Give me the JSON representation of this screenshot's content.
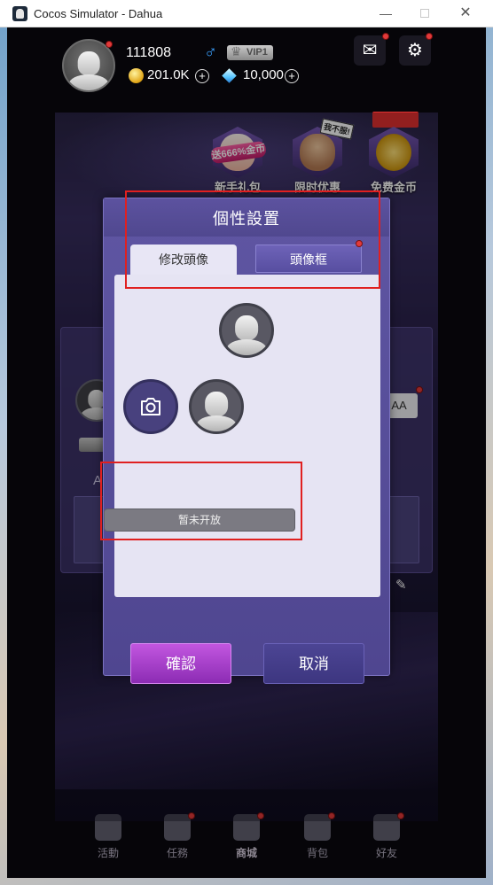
{
  "window": {
    "title": "Cocos Simulator - Dahua"
  },
  "header": {
    "user_id": "111808",
    "gender_symbol": "♂",
    "vip": "VIP1",
    "coins": "201.0K",
    "diamonds": "10,000",
    "plus_symbol": "+"
  },
  "promos": [
    {
      "label": "新手礼包",
      "tag": "送666%金币"
    },
    {
      "label": "限时优惠",
      "tag": "我不服!"
    },
    {
      "label": "免费金币"
    }
  ],
  "background_card": {
    "text_a": "A",
    "aa_label": "AA"
  },
  "modal": {
    "title": "個性設置",
    "tabs": [
      {
        "label": "修改頭像",
        "active": true
      },
      {
        "label": "頭像框",
        "active": false
      }
    ],
    "closed_label": "暂未开放",
    "confirm_label": "確認",
    "cancel_label": "取消"
  },
  "bottom_nav": [
    {
      "label": "活動",
      "icon": "calendar-star-icon"
    },
    {
      "label": "任務",
      "icon": "checklist-icon"
    },
    {
      "label": "商城",
      "icon": "cart-icon",
      "active": true
    },
    {
      "label": "背包",
      "icon": "bag-icon"
    },
    {
      "label": "好友",
      "icon": "friends-icon"
    }
  ],
  "colors": {
    "confirm": "#b04ad6",
    "modal": "#5a519c",
    "highlight": "#e02020",
    "notify_dot": "#e23a3a"
  }
}
